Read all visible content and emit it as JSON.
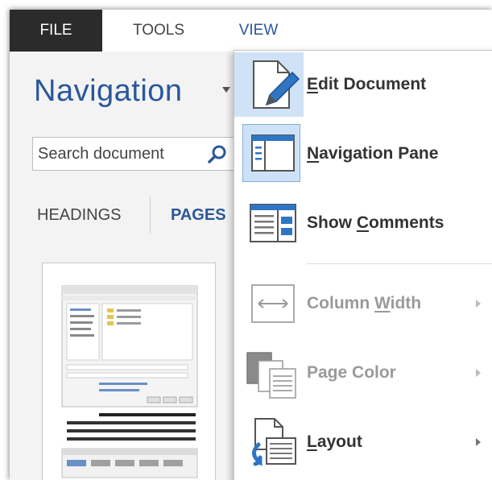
{
  "menubar": {
    "file": "FILE",
    "tools": "TOOLS",
    "view": "VIEW"
  },
  "navigation": {
    "title": "Navigation",
    "search_placeholder": "Search document",
    "tabs": [
      {
        "label": "HEADINGS",
        "active": false
      },
      {
        "label": "PAGES",
        "active": true
      }
    ]
  },
  "view_menu": {
    "items": [
      {
        "pre": "",
        "key": "E",
        "post": "dit Document",
        "icon": "edit-document-icon",
        "enabled": true,
        "submenu": false
      },
      {
        "pre": "",
        "key": "N",
        "post": "avigation Pane",
        "icon": "navigation-pane-icon",
        "enabled": true,
        "submenu": false,
        "checked": true
      },
      {
        "pre": "Show ",
        "key": "C",
        "post": "omments",
        "icon": "show-comments-icon",
        "enabled": true,
        "submenu": false
      },
      {
        "pre": "Column ",
        "key": "W",
        "post": "idth",
        "icon": "column-width-icon",
        "enabled": false,
        "submenu": true
      },
      {
        "pre": "Page Color",
        "key": "",
        "post": "",
        "icon": "page-color-icon",
        "enabled": false,
        "submenu": true
      },
      {
        "pre": "",
        "key": "L",
        "post": "ayout",
        "icon": "layout-icon",
        "enabled": true,
        "submenu": true
      }
    ]
  },
  "colors": {
    "accent": "#2b579a",
    "file_tab_bg": "#2b2b2b",
    "hover": "#cfe2f6"
  }
}
